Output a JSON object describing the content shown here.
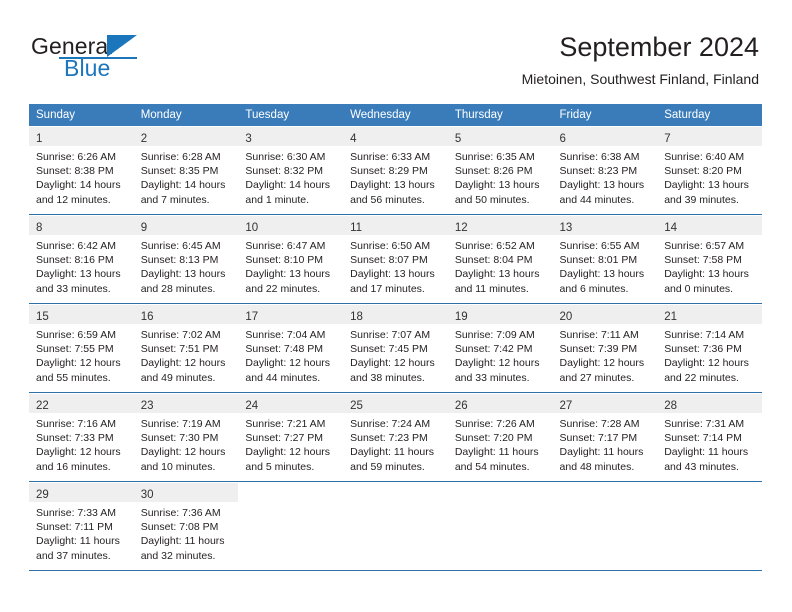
{
  "brand": {
    "name_top": "General",
    "name_bottom": "Blue",
    "accent_color": "#1c76bc"
  },
  "header": {
    "title": "September 2024",
    "subtitle": "Mietoinen, Southwest Finland, Finland"
  },
  "theme": {
    "header_row_bg": "#3a7cba",
    "daynum_band_bg": "#efefef",
    "rule_color": "#2f6fa8"
  },
  "weekday_headers": [
    "Sunday",
    "Monday",
    "Tuesday",
    "Wednesday",
    "Thursday",
    "Friday",
    "Saturday"
  ],
  "labels": {
    "sunrise_prefix": "Sunrise:",
    "sunset_prefix": "Sunset:",
    "daylight_prefix": "Daylight:"
  },
  "weeks": [
    [
      {
        "day": "1",
        "sunrise": "Sunrise: 6:26 AM",
        "sunset": "Sunset: 8:38 PM",
        "daylight_1": "Daylight: 14 hours",
        "daylight_2": "and 12 minutes."
      },
      {
        "day": "2",
        "sunrise": "Sunrise: 6:28 AM",
        "sunset": "Sunset: 8:35 PM",
        "daylight_1": "Daylight: 14 hours",
        "daylight_2": "and 7 minutes."
      },
      {
        "day": "3",
        "sunrise": "Sunrise: 6:30 AM",
        "sunset": "Sunset: 8:32 PM",
        "daylight_1": "Daylight: 14 hours",
        "daylight_2": "and 1 minute."
      },
      {
        "day": "4",
        "sunrise": "Sunrise: 6:33 AM",
        "sunset": "Sunset: 8:29 PM",
        "daylight_1": "Daylight: 13 hours",
        "daylight_2": "and 56 minutes."
      },
      {
        "day": "5",
        "sunrise": "Sunrise: 6:35 AM",
        "sunset": "Sunset: 8:26 PM",
        "daylight_1": "Daylight: 13 hours",
        "daylight_2": "and 50 minutes."
      },
      {
        "day": "6",
        "sunrise": "Sunrise: 6:38 AM",
        "sunset": "Sunset: 8:23 PM",
        "daylight_1": "Daylight: 13 hours",
        "daylight_2": "and 44 minutes."
      },
      {
        "day": "7",
        "sunrise": "Sunrise: 6:40 AM",
        "sunset": "Sunset: 8:20 PM",
        "daylight_1": "Daylight: 13 hours",
        "daylight_2": "and 39 minutes."
      }
    ],
    [
      {
        "day": "8",
        "sunrise": "Sunrise: 6:42 AM",
        "sunset": "Sunset: 8:16 PM",
        "daylight_1": "Daylight: 13 hours",
        "daylight_2": "and 33 minutes."
      },
      {
        "day": "9",
        "sunrise": "Sunrise: 6:45 AM",
        "sunset": "Sunset: 8:13 PM",
        "daylight_1": "Daylight: 13 hours",
        "daylight_2": "and 28 minutes."
      },
      {
        "day": "10",
        "sunrise": "Sunrise: 6:47 AM",
        "sunset": "Sunset: 8:10 PM",
        "daylight_1": "Daylight: 13 hours",
        "daylight_2": "and 22 minutes."
      },
      {
        "day": "11",
        "sunrise": "Sunrise: 6:50 AM",
        "sunset": "Sunset: 8:07 PM",
        "daylight_1": "Daylight: 13 hours",
        "daylight_2": "and 17 minutes."
      },
      {
        "day": "12",
        "sunrise": "Sunrise: 6:52 AM",
        "sunset": "Sunset: 8:04 PM",
        "daylight_1": "Daylight: 13 hours",
        "daylight_2": "and 11 minutes."
      },
      {
        "day": "13",
        "sunrise": "Sunrise: 6:55 AM",
        "sunset": "Sunset: 8:01 PM",
        "daylight_1": "Daylight: 13 hours",
        "daylight_2": "and 6 minutes."
      },
      {
        "day": "14",
        "sunrise": "Sunrise: 6:57 AM",
        "sunset": "Sunset: 7:58 PM",
        "daylight_1": "Daylight: 13 hours",
        "daylight_2": "and 0 minutes."
      }
    ],
    [
      {
        "day": "15",
        "sunrise": "Sunrise: 6:59 AM",
        "sunset": "Sunset: 7:55 PM",
        "daylight_1": "Daylight: 12 hours",
        "daylight_2": "and 55 minutes."
      },
      {
        "day": "16",
        "sunrise": "Sunrise: 7:02 AM",
        "sunset": "Sunset: 7:51 PM",
        "daylight_1": "Daylight: 12 hours",
        "daylight_2": "and 49 minutes."
      },
      {
        "day": "17",
        "sunrise": "Sunrise: 7:04 AM",
        "sunset": "Sunset: 7:48 PM",
        "daylight_1": "Daylight: 12 hours",
        "daylight_2": "and 44 minutes."
      },
      {
        "day": "18",
        "sunrise": "Sunrise: 7:07 AM",
        "sunset": "Sunset: 7:45 PM",
        "daylight_1": "Daylight: 12 hours",
        "daylight_2": "and 38 minutes."
      },
      {
        "day": "19",
        "sunrise": "Sunrise: 7:09 AM",
        "sunset": "Sunset: 7:42 PM",
        "daylight_1": "Daylight: 12 hours",
        "daylight_2": "and 33 minutes."
      },
      {
        "day": "20",
        "sunrise": "Sunrise: 7:11 AM",
        "sunset": "Sunset: 7:39 PM",
        "daylight_1": "Daylight: 12 hours",
        "daylight_2": "and 27 minutes."
      },
      {
        "day": "21",
        "sunrise": "Sunrise: 7:14 AM",
        "sunset": "Sunset: 7:36 PM",
        "daylight_1": "Daylight: 12 hours",
        "daylight_2": "and 22 minutes."
      }
    ],
    [
      {
        "day": "22",
        "sunrise": "Sunrise: 7:16 AM",
        "sunset": "Sunset: 7:33 PM",
        "daylight_1": "Daylight: 12 hours",
        "daylight_2": "and 16 minutes."
      },
      {
        "day": "23",
        "sunrise": "Sunrise: 7:19 AM",
        "sunset": "Sunset: 7:30 PM",
        "daylight_1": "Daylight: 12 hours",
        "daylight_2": "and 10 minutes."
      },
      {
        "day": "24",
        "sunrise": "Sunrise: 7:21 AM",
        "sunset": "Sunset: 7:27 PM",
        "daylight_1": "Daylight: 12 hours",
        "daylight_2": "and 5 minutes."
      },
      {
        "day": "25",
        "sunrise": "Sunrise: 7:24 AM",
        "sunset": "Sunset: 7:23 PM",
        "daylight_1": "Daylight: 11 hours",
        "daylight_2": "and 59 minutes."
      },
      {
        "day": "26",
        "sunrise": "Sunrise: 7:26 AM",
        "sunset": "Sunset: 7:20 PM",
        "daylight_1": "Daylight: 11 hours",
        "daylight_2": "and 54 minutes."
      },
      {
        "day": "27",
        "sunrise": "Sunrise: 7:28 AM",
        "sunset": "Sunset: 7:17 PM",
        "daylight_1": "Daylight: 11 hours",
        "daylight_2": "and 48 minutes."
      },
      {
        "day": "28",
        "sunrise": "Sunrise: 7:31 AM",
        "sunset": "Sunset: 7:14 PM",
        "daylight_1": "Daylight: 11 hours",
        "daylight_2": "and 43 minutes."
      }
    ],
    [
      {
        "day": "29",
        "sunrise": "Sunrise: 7:33 AM",
        "sunset": "Sunset: 7:11 PM",
        "daylight_1": "Daylight: 11 hours",
        "daylight_2": "and 37 minutes."
      },
      {
        "day": "30",
        "sunrise": "Sunrise: 7:36 AM",
        "sunset": "Sunset: 7:08 PM",
        "daylight_1": "Daylight: 11 hours",
        "daylight_2": "and 32 minutes."
      },
      {
        "day": "",
        "sunrise": "",
        "sunset": "",
        "daylight_1": "",
        "daylight_2": ""
      },
      {
        "day": "",
        "sunrise": "",
        "sunset": "",
        "daylight_1": "",
        "daylight_2": ""
      },
      {
        "day": "",
        "sunrise": "",
        "sunset": "",
        "daylight_1": "",
        "daylight_2": ""
      },
      {
        "day": "",
        "sunrise": "",
        "sunset": "",
        "daylight_1": "",
        "daylight_2": ""
      },
      {
        "day": "",
        "sunrise": "",
        "sunset": "",
        "daylight_1": "",
        "daylight_2": ""
      }
    ]
  ]
}
